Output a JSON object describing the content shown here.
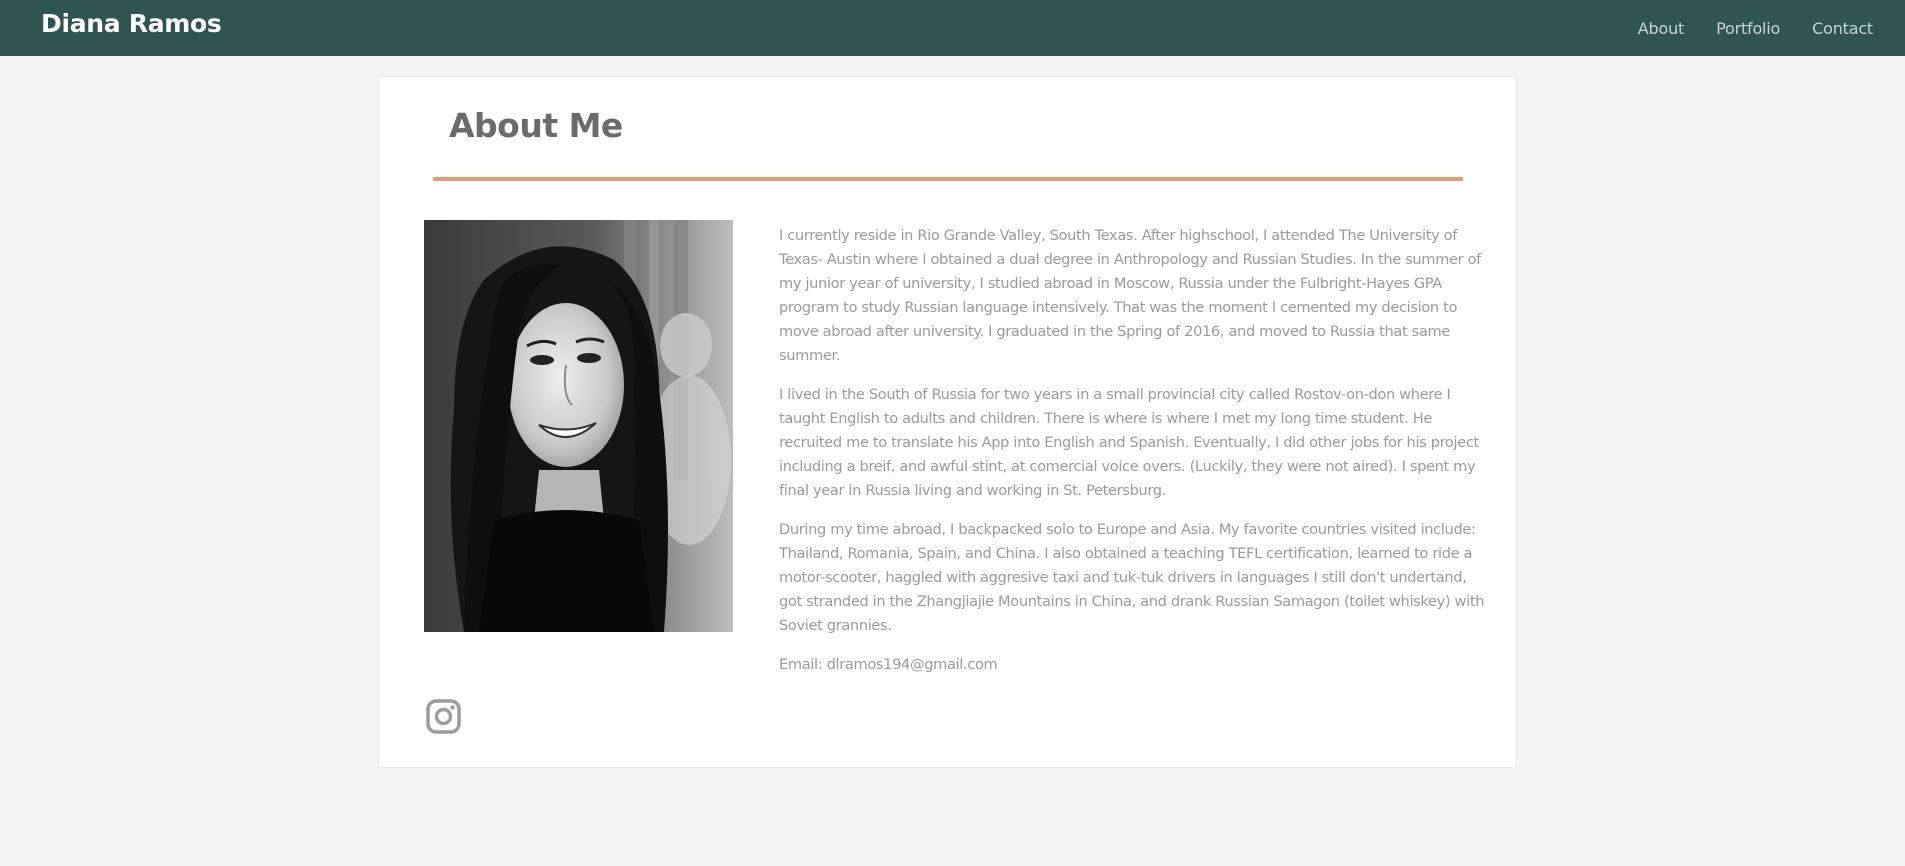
{
  "brand": "Diana Ramos",
  "nav": {
    "links": [
      "About",
      "Portfolio",
      "Contact"
    ]
  },
  "about": {
    "heading": "About Me",
    "paragraphs": [
      "I currently reside in Rio Grande Valley, South Texas. After highschool, I attended The University of Texas- Austin where I obtained a dual degree in Anthropology and Russian Studies. In the summer of my junior year of university, I studied abroad in Moscow, Russia under the Fulbright-Hayes GPA program to study Russian language intensively. That was the moment I cemented my decision to move abroad after university. I graduated in the Spring of 2016, and moved to Russia that same summer.",
      "I lived in the South of Russia for two years in a small provincial city called Rostov-on-don where I taught English to adults and children. There is where is where I met my long time student. He recruited me to translate his App into English and Spanish. Eventually, I did other jobs for his project including a breif, and awful stint, at comercial voice overs. (Luckily, they were not aired). I spent my final year in Russia living and working in St. Petersburg.",
      "During my time abroad, I backpacked solo to Europe and Asia. My favorite countries visited include: Thailand, Romania, Spain, and China. I also obtained a teaching TEFL certification, learned to ride a motor-scooter, haggled with aggresive taxi and tuk-tuk drivers in languages I still don't undertand, got stranded in the Zhangjiajie Mountains in China, and drank Russian Samagon (toilet whiskey) with Soviet grannies."
    ],
    "email": "Email: dlramos194@gmail.com"
  },
  "icons": {
    "social": "instagram-icon",
    "photo": "portrait-photo"
  },
  "colors": {
    "navbar": "#2f5451",
    "accent_divider": "#e29a7c",
    "heading": "#6b6b6b",
    "body_text": "#9a9a9a",
    "page_bg": "#f4f4f4"
  }
}
